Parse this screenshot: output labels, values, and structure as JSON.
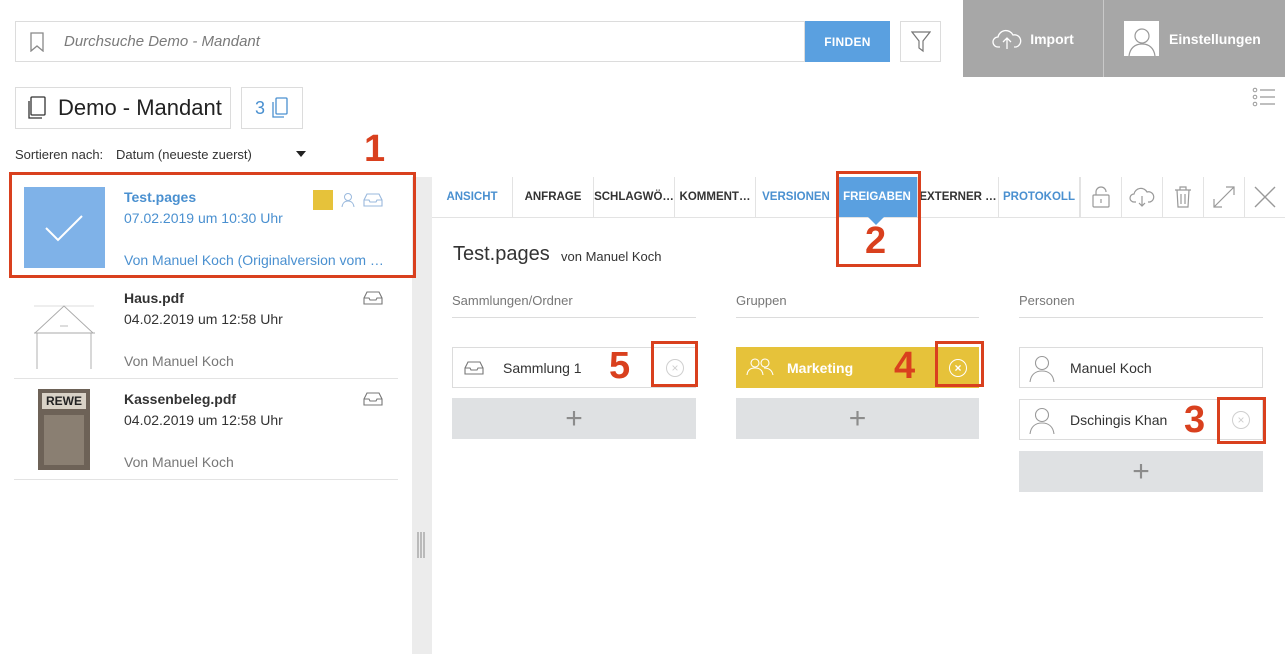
{
  "search": {
    "placeholder": "Durchsuche Demo - Mandant",
    "find_label": "FINDEN"
  },
  "header": {
    "import_label": "Import",
    "settings_label": "Einstellungen"
  },
  "mandant": {
    "name": "Demo - Mandant",
    "doc_count": "3"
  },
  "sort": {
    "label": "Sortieren nach:",
    "value": "Datum (neueste zuerst)"
  },
  "documents": [
    {
      "title": "Test.pages",
      "date": "07.02.2019 um 10:30 Uhr",
      "author": "Von Manuel Koch (Originalversion vom 3…"
    },
    {
      "title": "Haus.pdf",
      "date": "04.02.2019 um 12:58 Uhr",
      "author": "Von Manuel Koch"
    },
    {
      "title": "Kassenbeleg.pdf",
      "date": "04.02.2019 um 12:58 Uhr",
      "author": "Von Manuel Koch",
      "thumb_text": "REWE"
    }
  ],
  "tabs": [
    "ANSICHT",
    "ANFRAGE",
    "SCHLAGWÖ…",
    "KOMMENT…",
    "VERSIONEN",
    "FREIGABEN",
    "EXTERNER …",
    "PROTOKOLL"
  ],
  "detail": {
    "title": "Test.pages",
    "by": "von Manuel Koch",
    "columns": {
      "collections": {
        "heading": "Sammlungen/Ordner",
        "items": [
          "Sammlung 1"
        ]
      },
      "groups": {
        "heading": "Gruppen",
        "items": [
          "Marketing"
        ]
      },
      "persons": {
        "heading": "Personen",
        "items": [
          "Manuel Koch",
          "Dschingis Khan"
        ]
      }
    }
  },
  "annotations": [
    "1",
    "2",
    "3",
    "4",
    "5"
  ],
  "colors": {
    "accent": "#5aa0e0",
    "link": "#4a90d0",
    "yellow": "#e6c23a",
    "highlight": "#d9401e"
  }
}
